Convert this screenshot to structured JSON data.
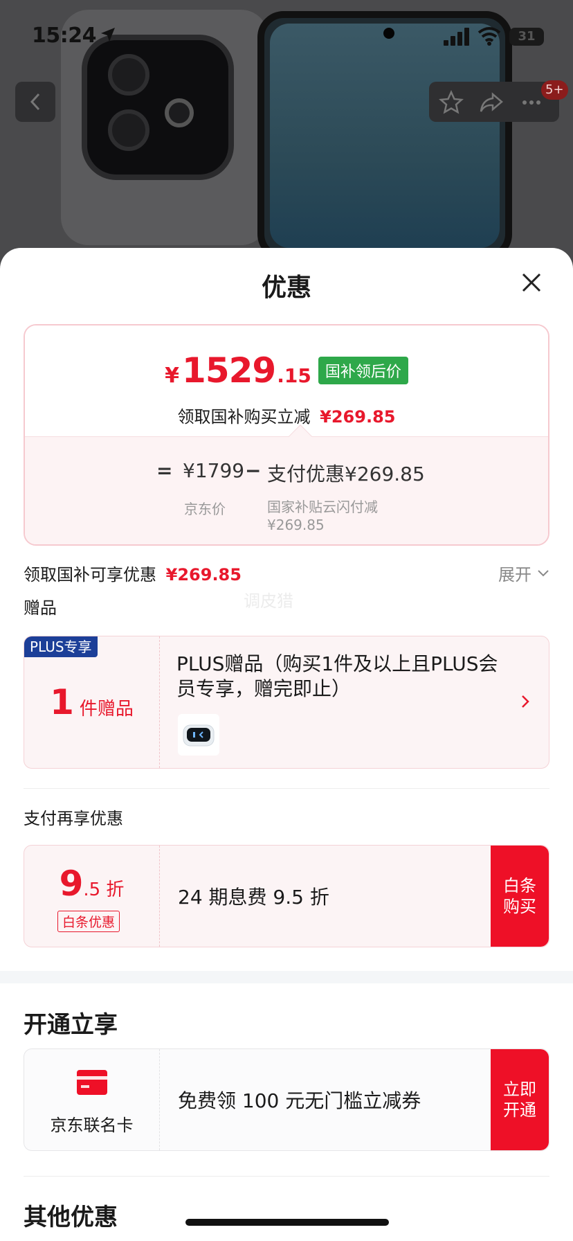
{
  "status": {
    "time": "15:24",
    "battery": "31"
  },
  "nav": {
    "badge": "5+"
  },
  "sheet": {
    "title": "优惠",
    "price": {
      "yen": "¥",
      "integer": "1529",
      "decimal": ".15",
      "tag": "国补领后价",
      "sub_text": "领取国补购买立减",
      "sub_amount": "¥269.85"
    },
    "formula": {
      "eq": "=",
      "jd_price": "¥1799",
      "minus": "−",
      "pay_discount": "支付优惠¥269.85",
      "jd_label": "京东价",
      "subsidy_label": "国家补贴云闪付减 ¥269.85"
    },
    "subsidy_row": {
      "label": "领取国补可享优惠",
      "amount": "¥269.85",
      "expand": "展开"
    },
    "watermark": "调皮猎",
    "gifts": {
      "label": "赠品",
      "plus_tag": "PLUS专享",
      "count": "1",
      "unit": "件赠品",
      "text": "PLUS赠品（购买1件及以上且PLUS会员专享，赠完即止）"
    },
    "pay": {
      "label": "支付再享优惠",
      "discount_int": "9",
      "discount_dec": ".5 折",
      "badge": "白条优惠",
      "desc": "24 期息费 9.5 折",
      "button": "白条\n购买"
    },
    "open": {
      "label": "开通立享",
      "card_name": "京东联名卡",
      "desc": "免费领 100 元无门槛立减券",
      "button": "立即\n开通"
    },
    "other": {
      "label": "其他优惠"
    }
  }
}
